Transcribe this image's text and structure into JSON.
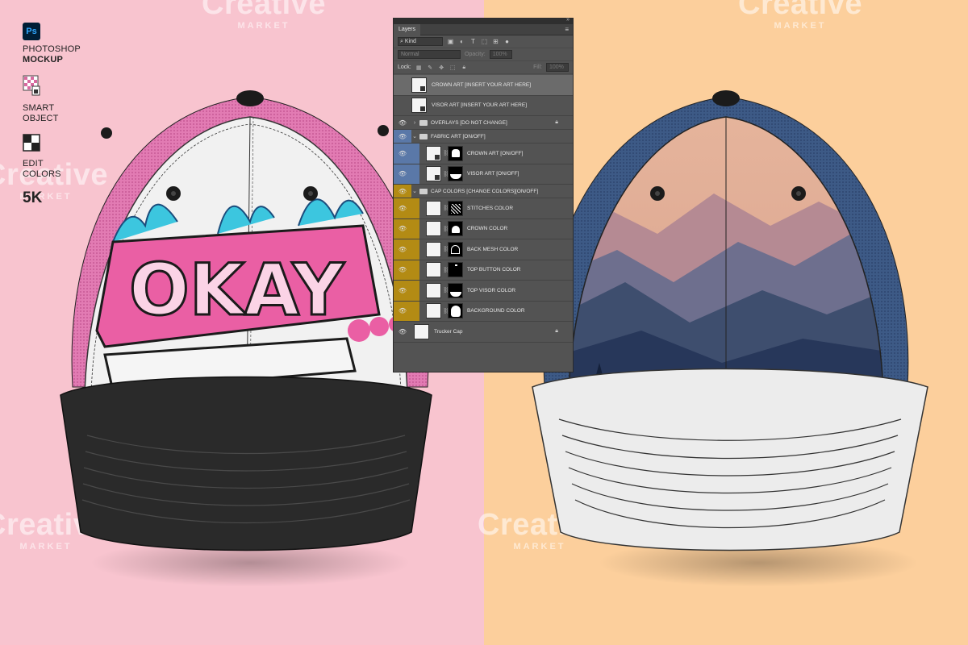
{
  "features": [
    {
      "line1": "PHOTOSHOP",
      "line2": "MOCKUP"
    },
    {
      "line1": "SMART",
      "line2": "OBJECT"
    },
    {
      "line1": "EDIT",
      "line2": "COLORS"
    }
  ],
  "ps_badge": "Ps",
  "resolution": "5K",
  "watermark": {
    "word": "Creative",
    "sub": "MARKET"
  },
  "left_cap_art_text": "OKAY",
  "panel": {
    "tab": "Layers",
    "kind": "Kind",
    "blend_mode": "Normal",
    "opacity_label": "Opacity:",
    "opacity_value": "100%",
    "lock_label": "Lock:",
    "fill_label": "Fill:",
    "fill_value": "100%",
    "layers": [
      {
        "name": "CROWN ART [INSERT YOUR ART HERE]"
      },
      {
        "name": "VISOR ART [INSERT YOUR ART HERE]"
      },
      {
        "name": "OVERLAYS [DO NOT CHANGE]"
      },
      {
        "name": "FABRIC ART [ON/OFF]"
      },
      {
        "name": "CROWN ART [ON/OFF]"
      },
      {
        "name": "VISOR ART [ON/OFF]"
      },
      {
        "name": "CAP COLORS [CHANGE COLORS][ON/OFF]"
      },
      {
        "name": "STITCHES COLOR"
      },
      {
        "name": "CROWN COLOR"
      },
      {
        "name": "BACK MESH COLOR"
      },
      {
        "name": "TOP BUTTON COLOR"
      },
      {
        "name": "TOP VISOR COLOR"
      },
      {
        "name": "BACKGROUND COLOR"
      },
      {
        "name": "Trucker Cap"
      }
    ]
  },
  "colors": {
    "left_background": "#f8c4cf",
    "right_background": "#fccf9c",
    "fabric_group": "#5a78a8",
    "colors_group": "#b38b14"
  }
}
